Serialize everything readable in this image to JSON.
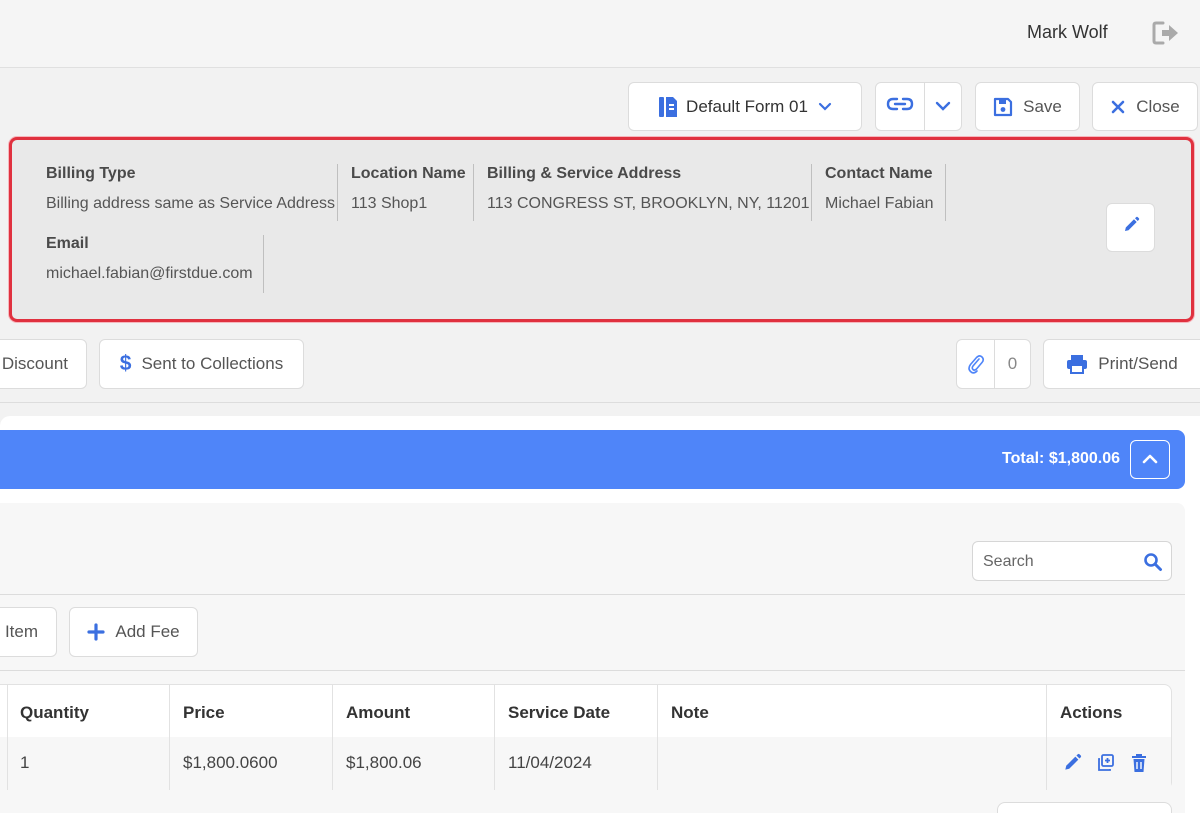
{
  "header": {
    "user_name": "Mark Wolf"
  },
  "toolbar": {
    "form_label": "Default Form 01",
    "save_label": "Save",
    "close_label": "Close"
  },
  "info": {
    "billing_type": {
      "label": "Billing Type",
      "value": "Billing address same as Service Address"
    },
    "location_name": {
      "label": "Location Name",
      "value": "113 Shop1"
    },
    "address": {
      "label": "Billing & Service Address",
      "value": "113 CONGRESS ST, BROOKLYN, NY, 11201"
    },
    "contact_name": {
      "label": "Contact Name",
      "value": "Michael Fabian"
    },
    "email": {
      "label": "Email",
      "value": "michael.fabian@firstdue.com"
    }
  },
  "actions": {
    "discount_label": "Discount",
    "collections_label": "Sent to Collections",
    "attachments_count": "0",
    "print_label": "Print/Send"
  },
  "summary": {
    "total": "Total: $1,800.06"
  },
  "items": {
    "search_placeholder": "Search",
    "add_item_label": "Item",
    "add_fee_label": "Add Fee"
  },
  "table": {
    "headers": [
      "Quantity",
      "Price",
      "Amount",
      "Service Date",
      "Note",
      "Actions"
    ],
    "rows": [
      {
        "quantity": "1",
        "price": "$1,800.0600",
        "amount": "$1,800.06",
        "service_date": "11/04/2024",
        "note": ""
      }
    ]
  },
  "colors": {
    "accent": "#4f85f9",
    "highlight": "#e0313f",
    "icon": "#3b6fe0"
  }
}
